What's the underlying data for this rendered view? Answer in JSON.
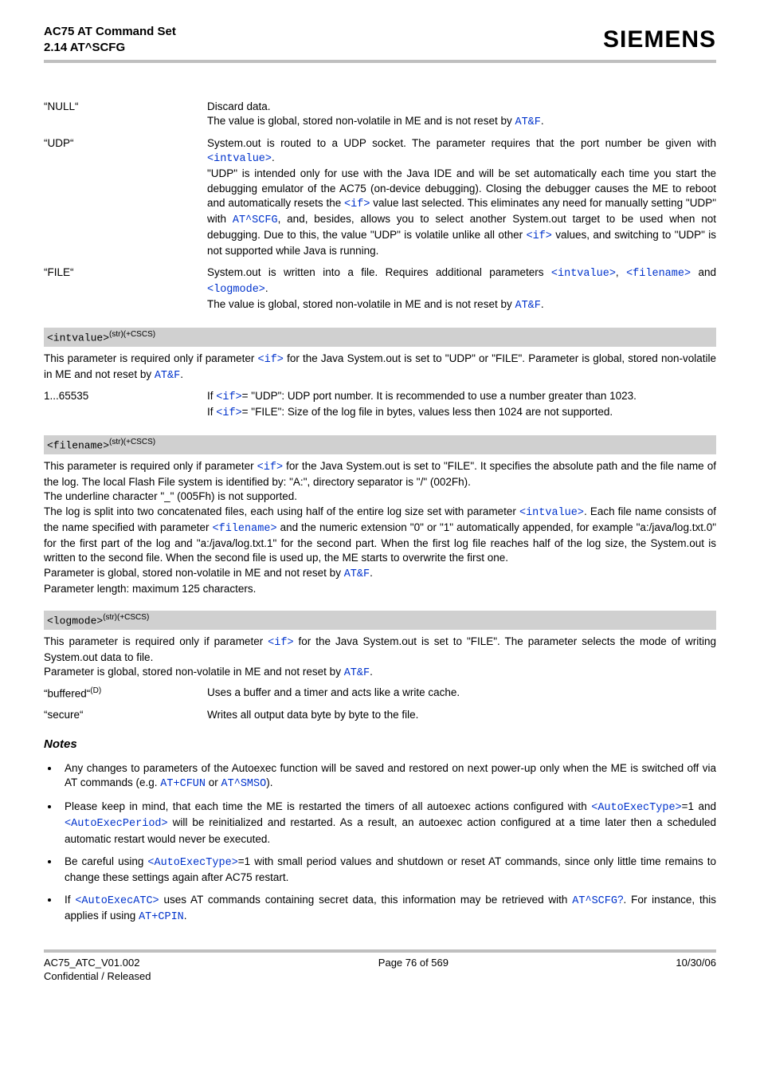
{
  "header": {
    "title_l1": "AC75 AT Command Set",
    "title_l2": "2.14 AT^SCFG",
    "brand": "SIEMENS"
  },
  "defs1": [
    {
      "term": "“NULL“",
      "desc": "Discard data.<br>The value is global, stored non-volatile in ME and is not reset by <a class='link'>AT&amp;F</a>."
    },
    {
      "term": "“UDP“",
      "desc": "System.out is routed to a UDP socket. The parameter requires that the port number be given with <a class='link'>&lt;intvalue&gt;</a>.<br>\"UDP\" is intended only for use with the Java IDE and will be set automatically each time you start the debugging emulator of the AC75 (on-device debugging). Closing the debugger causes the ME to reboot and automatically resets the <a class='link'>&lt;if&gt;</a> value last selected. This eliminates any need for manually setting \"UDP\" with <a class='link'>AT^SCFG</a>, and, besides, allows you to select another System.out target to be used when not debugging. Due to this, the value \"UDP\" is volatile unlike all other <a class='link'>&lt;if&gt;</a> values, and switching to \"UDP\" is not supported while Java is running."
    },
    {
      "term": "“FILE“",
      "desc": "System.out is written into a file. Requires additional parameters <a class='link'>&lt;intvalue&gt;</a>, <a class='link'>&lt;filename&gt;</a> and <a class='link'>&lt;logmode&gt;</a>.<br>The value is global, stored non-volatile in ME and is not reset by <a class='link'>AT&amp;F</a>."
    }
  ],
  "param_intvalue": {
    "name": "&lt;intvalue&gt;",
    "sup": "(str)(+CSCS)",
    "intro": "This parameter is required only if parameter <a class='link'>&lt;if&gt;</a> for the Java System.out is set to \"UDP\" or \"FILE\". Parameter is global, stored non-volatile in ME and not reset by <a class='link'>AT&amp;F</a>.",
    "rows": [
      {
        "term": "1...65535",
        "desc": "If <a class='link'>&lt;if&gt;</a>= \"UDP\": UDP port number. It is recommended to use a number greater than 1023.<br>If <a class='link'>&lt;if&gt;</a>= \"FILE\": Size of the log file in bytes, values less then 1024 are not supported."
      }
    ]
  },
  "param_filename": {
    "name": "&lt;filename&gt;",
    "sup": "(str)(+CSCS)",
    "body": "This parameter is required only if parameter <a class='link'>&lt;if&gt;</a> for the Java System.out is set to \"FILE\". It specifies the absolute path and the file name of the log. The local Flash File system is identified by: \"A:\", directory separator is \"/\" (002Fh).<br>The underline character \"_\" (005Fh) is not supported.<br>The log is split into two concatenated files, each using half of the entire log size set with parameter <a class='link'>&lt;intvalue&gt;</a>. Each file name consists of the name specified with parameter <a class='link'>&lt;filename&gt;</a> and the numeric extension \"0\" or \"1\" automatically appended, for example \"a:/java/log.txt.0\" for the first part of the log and \"a:/java/log.txt.1\" for the second part. When the first log file reaches half of the log size, the System.out is written to the second file. When the second file is used up, the ME starts to overwrite the first one.<br>Parameter is global, stored non-volatile in ME and not reset by <a class='link'>AT&amp;F</a>.<br>Parameter length: maximum 125 characters."
  },
  "param_logmode": {
    "name": "&lt;logmode&gt;",
    "sup": "(str)(+CSCS)",
    "intro": "This parameter is required only if parameter <a class='link'>&lt;if&gt;</a> for the Java System.out is set to \"FILE\". The parameter selects the mode of writing System.out data to file.<br>Parameter is global, stored non-volatile in ME and not reset by <a class='link'>AT&amp;F</a>.",
    "rows": [
      {
        "term": "“buffered“<sup>(D)</sup>",
        "desc": "Uses a buffer and a timer and acts like a write cache."
      },
      {
        "term": "“secure“",
        "desc": "Writes all output data byte by byte to the file."
      }
    ]
  },
  "notes_head": "Notes",
  "notes": [
    "Any changes to parameters of the Autoexec function will be saved and restored on next power-up only when the ME is switched off via AT commands (e.g. <a class='link'>AT+CFUN</a> or <a class='link'>AT^SMSO</a>).",
    "Please keep in mind, that each time the ME is restarted the timers of all autoexec actions configured with <a class='link'>&lt;AutoExecType&gt;</a>=1 and <a class='link'>&lt;AutoExecPeriod&gt;</a> will be reinitialized and restarted. As a result, an autoexec action configured at a time later then a scheduled automatic restart would never be executed.",
    "Be careful using <a class='link'>&lt;AutoExecType&gt;</a>=1 with small period values and shutdown or reset AT commands, since only little time remains to change these settings again after AC75 restart.",
    "If <a class='link'>&lt;AutoExecATC&gt;</a> uses AT commands containing secret data, this information may be retrieved with <a class='link'>AT^SCFG</a><span class='linkplain'>?</span>. For instance, this applies if using <a class='link'>AT+CPIN</a>."
  ],
  "footer": {
    "left_l1": "AC75_ATC_V01.002",
    "left_l2": "Confidential / Released",
    "center": "Page 76 of 569",
    "right": "10/30/06"
  }
}
